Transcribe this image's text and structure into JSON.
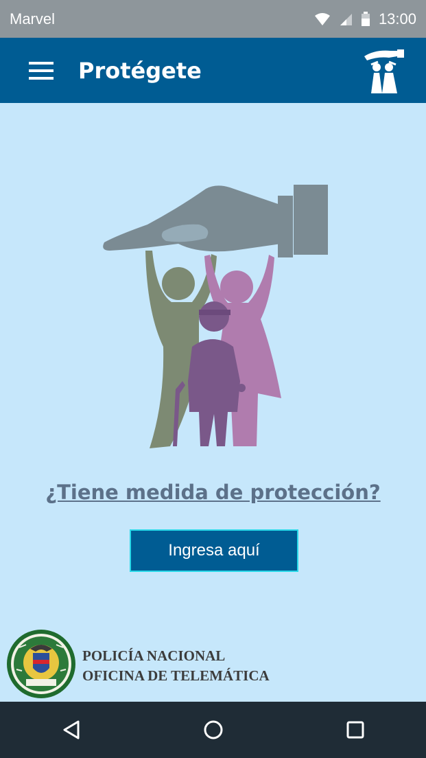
{
  "status_bar": {
    "carrier": "Marvel",
    "time": "13:00",
    "icons": [
      "wifi-icon",
      "cell-signal-icon",
      "battery-icon"
    ]
  },
  "app_bar": {
    "title": "Protégete",
    "menu_icon": "hamburger-menu-icon",
    "logo_icon": "protective-hand-family-logo"
  },
  "hero": {
    "image": "protective-hand-over-family-illustration"
  },
  "main": {
    "question_link": "¿Tiene medida de protección?",
    "button_label": "Ingresa aquí"
  },
  "footer": {
    "line1": "POLICÍA NACIONAL",
    "line2": "OFICINA DE TELEMÁTICA",
    "seal_icon": "policia-nacional-seal"
  },
  "nav_bar": {
    "icons": [
      "back-icon",
      "home-icon",
      "recents-icon"
    ]
  },
  "colors": {
    "app_bar": "#005c93",
    "background": "#c6e7fb",
    "status_bar": "#8e969b",
    "nav_bar": "#1f2c36",
    "button_border": "#2ad9e8",
    "link": "#5c7189"
  }
}
